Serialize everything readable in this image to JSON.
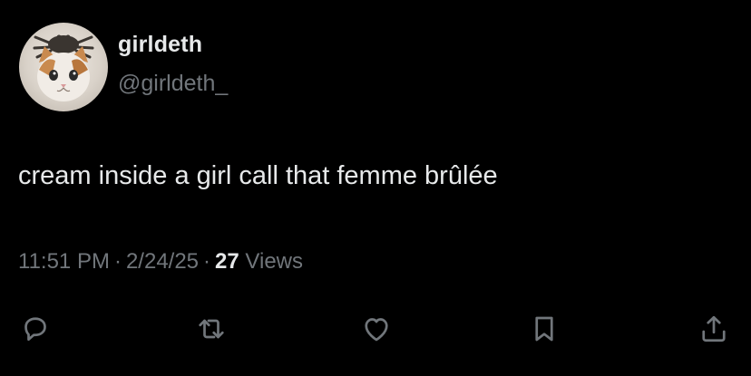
{
  "tweet": {
    "display_name": "girldeth",
    "handle": "@girldeth_",
    "text": "cream inside a girl call that femme brûlée",
    "time": "11:51 PM",
    "date": "2/24/25",
    "separator": "·",
    "views_count": "27",
    "views_label": "Views"
  },
  "actions": [
    {
      "name": "reply",
      "icon": "reply-icon"
    },
    {
      "name": "retweet",
      "icon": "retweet-icon"
    },
    {
      "name": "like",
      "icon": "heart-icon"
    },
    {
      "name": "bookmark",
      "icon": "bookmark-icon"
    },
    {
      "name": "share",
      "icon": "share-icon"
    }
  ],
  "colors": {
    "background": "#000000",
    "primary_text": "#e7e9ea",
    "secondary_text": "#71767b"
  }
}
